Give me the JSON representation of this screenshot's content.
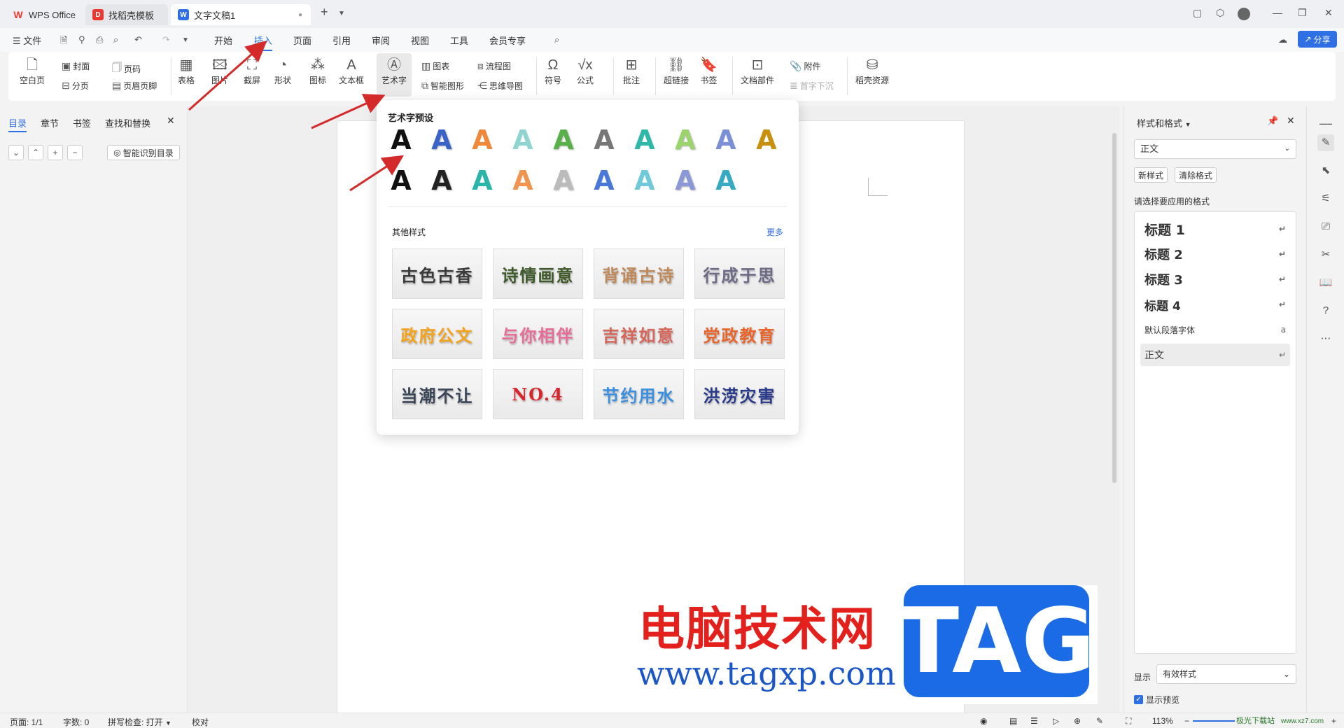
{
  "titlebar": {
    "tabs": [
      {
        "label": "WPS Office",
        "color": "#e8382f"
      },
      {
        "label": "找稻壳模板",
        "color": "#e8382f"
      },
      {
        "label": "文字文稿1",
        "color": "#2f6fe4"
      }
    ],
    "new_tab": "+"
  },
  "menubar": {
    "file": "☰ 文件",
    "items": [
      "开始",
      "插入",
      "页面",
      "引用",
      "审阅",
      "视图",
      "工具",
      "会员专享"
    ],
    "active": "插入",
    "share": "分享"
  },
  "ribbon": {
    "blank_page": "空白页",
    "cover": "封面",
    "page_break": "分页",
    "page_number": "页码",
    "header_footer": "页眉页脚",
    "table": "表格",
    "picture": "图片",
    "screenshot": "截屏",
    "shape": "形状",
    "icon": "图标",
    "textbox": "文本框",
    "wordart": "艺术字",
    "chart": "图表",
    "smart_graphic": "智能图形",
    "flowchart": "流程图",
    "mindmap": "思维导图",
    "symbol": "符号",
    "formula": "公式",
    "comment": "批注",
    "hyperlink": "超链接",
    "bookmark": "书签",
    "doc_parts": "文档部件",
    "attachment": "附件",
    "dropcap": "首字下沉",
    "resources": "稻壳资源"
  },
  "leftpane": {
    "tabs": [
      "目录",
      "章节",
      "书签",
      "查找和替换"
    ],
    "smart_toc": "智能识别目录"
  },
  "wordart_popup": {
    "preset_title": "艺术字预设",
    "presets_row1": [
      "A",
      "A",
      "A",
      "A",
      "A",
      "A",
      "A",
      "A",
      "A",
      "A"
    ],
    "presets_row2": [
      "A",
      "A",
      "A",
      "A",
      "A",
      "A",
      "A",
      "A",
      "A"
    ],
    "colors_row1": [
      "#111111",
      "#3a63c8",
      "#f0883a",
      "#8fd4d0",
      "#58b048",
      "#777777",
      "#2fb7a8",
      "#9bd46a",
      "#7a8fd8",
      "#c8900c"
    ],
    "colors_row2": [
      "#111111",
      "#222222",
      "#2ab5a8",
      "#f09550",
      "#bbbbbb",
      "#4a78d8",
      "#6fc9d8",
      "#8a98d8",
      "#37a9c2"
    ],
    "other_title": "其他样式",
    "more": "更多",
    "styles": [
      {
        "text": "古色古香",
        "color": "#3a3a3a"
      },
      {
        "text": "诗情画意",
        "color": "#3f5a2a"
      },
      {
        "text": "背诵古诗",
        "color": "#c0895a"
      },
      {
        "text": "行成于思",
        "color": "#6c6a86"
      },
      {
        "text": "政府公文",
        "color": "#f3a21a"
      },
      {
        "text": "与你相伴",
        "color": "#e86c98"
      },
      {
        "text": "吉祥如意",
        "color": "#d6655a"
      },
      {
        "text": "党政教育",
        "color": "#e8642a"
      },
      {
        "text": "当潮不让",
        "color": "#3a4658"
      },
      {
        "text": "NO.4",
        "color": "#d8262c"
      },
      {
        "text": "节约用水",
        "color": "#3a8fe0"
      },
      {
        "text": "洪涝灾害",
        "color": "#2a3a8a"
      }
    ]
  },
  "rightpane": {
    "title": "样式和格式",
    "current_style": "正文",
    "new_style": "新样式",
    "clear_format": "清除格式",
    "hint": "请选择要应用的格式",
    "styles": [
      "标题  1",
      "标题  2",
      "标题  3",
      "标题  4",
      "默认段落字体",
      "正文"
    ],
    "show_label": "显示",
    "show_value": "有效样式",
    "preview": "显示预览"
  },
  "statusbar": {
    "page": "页面: 1/1",
    "words": "字数: 0",
    "spell": "拼写检查: 打开",
    "proof": "校对",
    "zoom": "113%"
  },
  "watermark": {
    "cn": "电脑技术网",
    "url": "www.tagxp.com",
    "tag": "TAG",
    "site": "极光下载站",
    "site_url": "www.xz7.com"
  }
}
